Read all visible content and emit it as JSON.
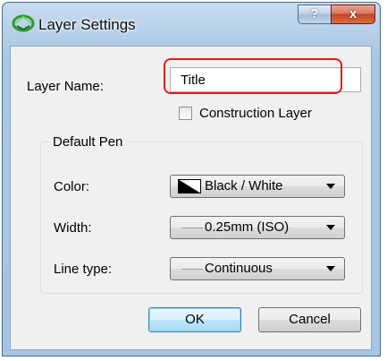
{
  "window": {
    "title": "Layer Settings",
    "help_label": "?",
    "close_label": "x"
  },
  "form": {
    "layer_name_label": "Layer Name:",
    "layer_name_value": "Title",
    "construction_layer_label": "Construction Layer",
    "construction_layer_checked": false
  },
  "default_pen": {
    "group_title": "Default Pen",
    "color_label": "Color:",
    "color_value": "Black / White",
    "width_label": "Width:",
    "width_value": "0.25mm (ISO)",
    "linetype_label": "Line type:",
    "linetype_value": "Continuous"
  },
  "buttons": {
    "ok_label": "OK",
    "cancel_label": "Cancel"
  },
  "colors": {
    "highlight": "#e31b1b",
    "default_button_border": "#3c7fb1"
  }
}
